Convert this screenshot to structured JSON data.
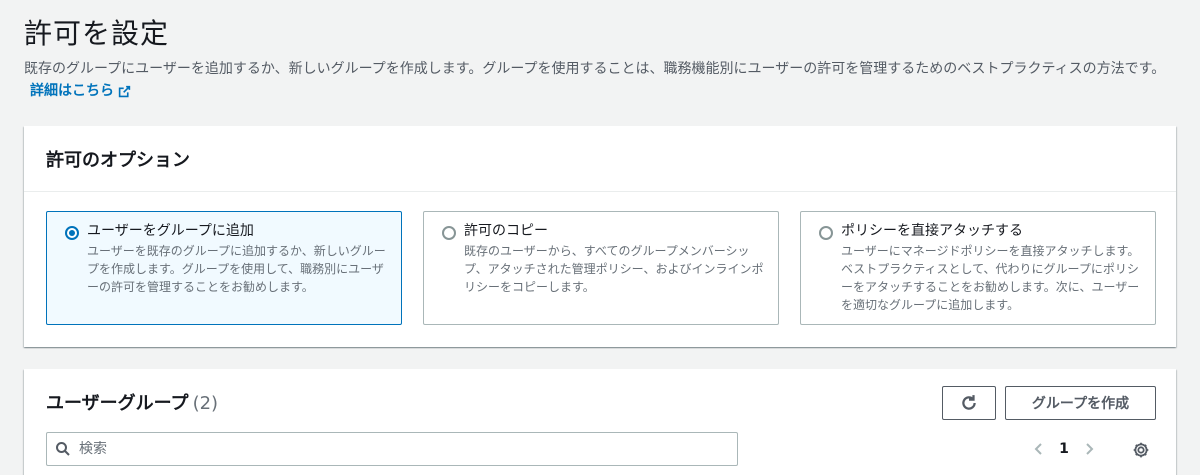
{
  "header": {
    "title": "許可を設定",
    "description": "既存のグループにユーザーを追加するか、新しいグループを作成します。グループを使用することは、職務機能別にユーザーの許可を管理するためのベストプラクティスの方法です。",
    "learn_more": "詳細はこちら"
  },
  "options_panel": {
    "title": "許可のオプション",
    "options": [
      {
        "title": "ユーザーをグループに追加",
        "description": "ユーザーを既存のグループに追加するか、新しいグループを作成します。グループを使用して、職務別にユーザーの許可を管理することをお勧めします。",
        "selected": true
      },
      {
        "title": "許可のコピー",
        "description": "既存のユーザーから、すべてのグループメンバーシップ、アタッチされた管理ポリシー、およびインラインポリシーをコピーします。",
        "selected": false
      },
      {
        "title": "ポリシーを直接アタッチする",
        "description": "ユーザーにマネージドポリシーを直接アタッチします。ベストプラクティスとして、代わりにグループにポリシーをアタッチすることをお勧めします。次に、ユーザーを適切なグループに追加します。",
        "selected": false
      }
    ]
  },
  "groups_panel": {
    "title": "ユーザーグループ",
    "count": "(2)",
    "create_button": "グループを作成",
    "search_placeholder": "検索",
    "current_page": "1"
  },
  "colors": {
    "accent": "#0073bb",
    "selected_bg": "#f1faff",
    "background": "#f2f3f3"
  },
  "icons": [
    "external-link-icon",
    "refresh-icon",
    "search-icon",
    "chevron-left-icon",
    "chevron-right-icon",
    "gear-icon"
  ]
}
